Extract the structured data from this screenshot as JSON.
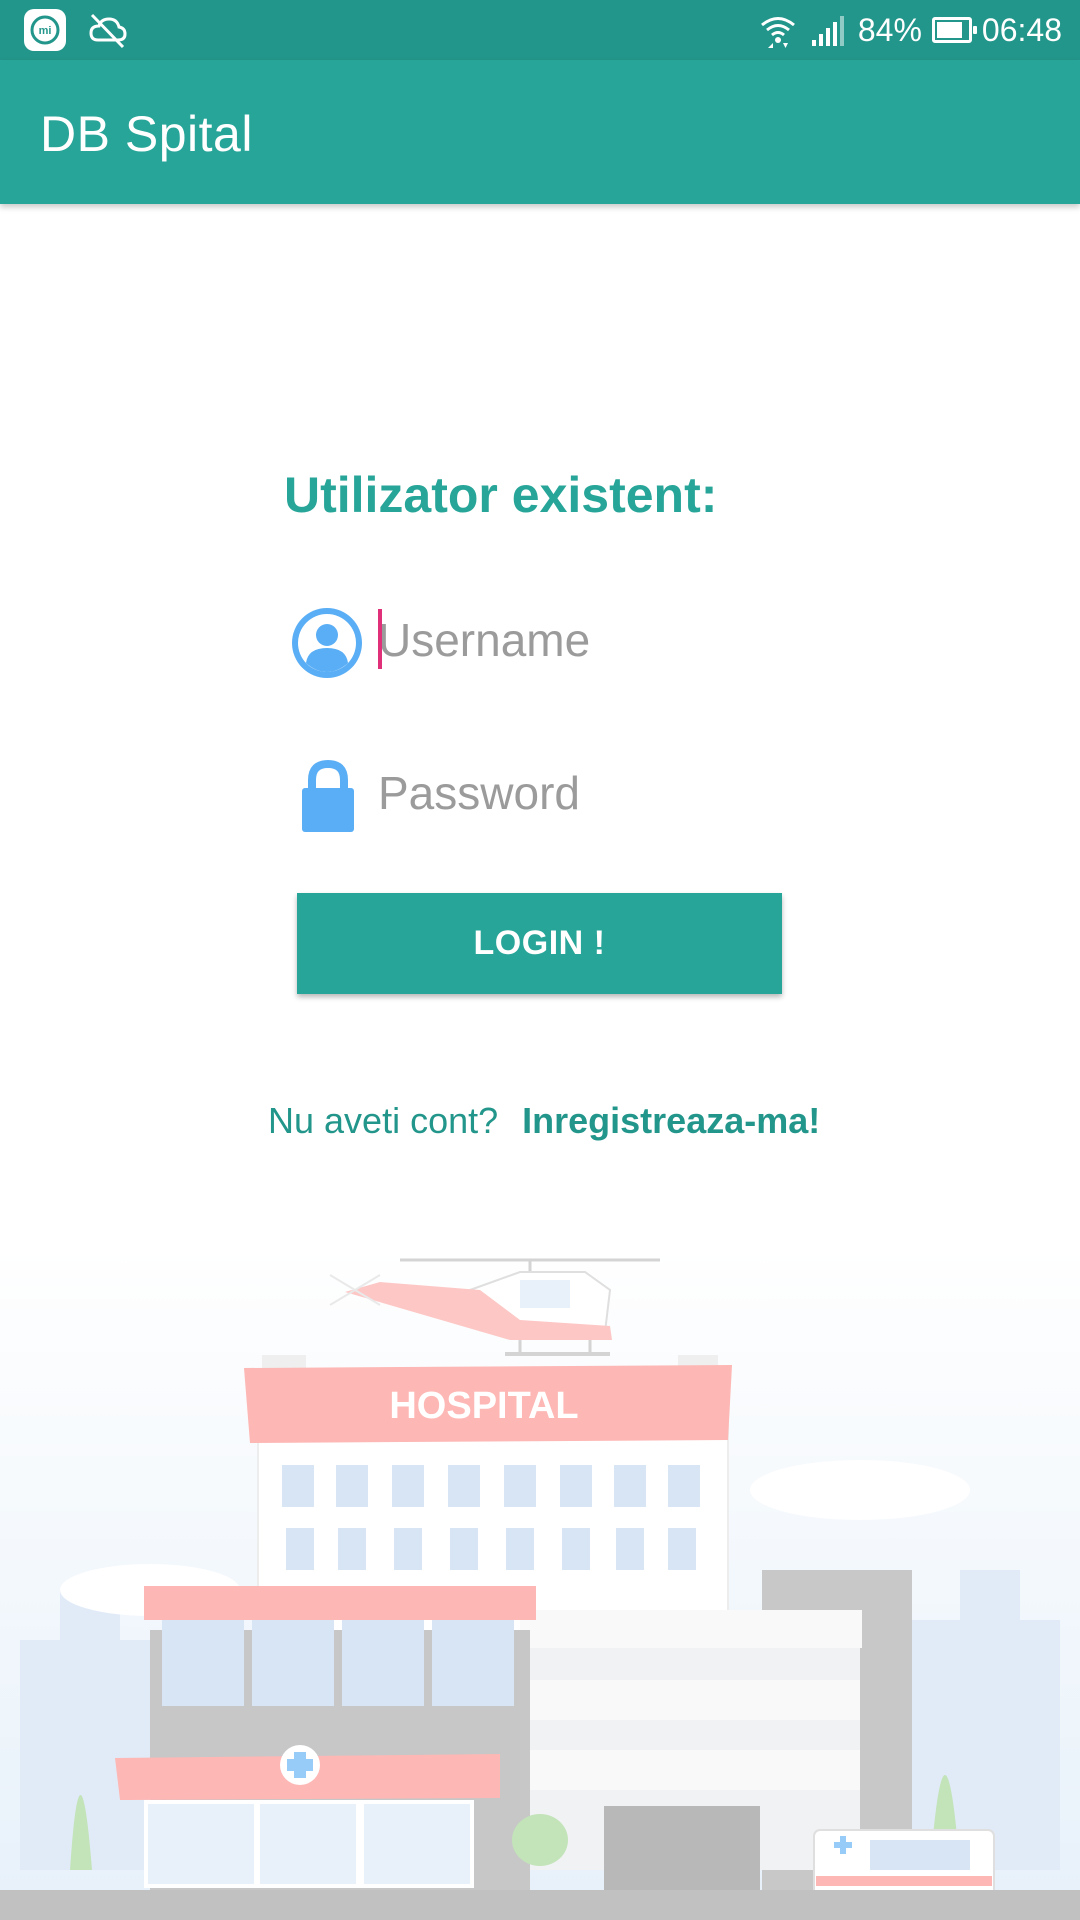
{
  "status_bar": {
    "battery": "84%",
    "battery_level": 0.84,
    "time": "06:48",
    "icons": [
      "miui-app-icon",
      "cloud-off-icon",
      "wifi-icon",
      "signal-icon",
      "battery-icon"
    ]
  },
  "app_bar": {
    "title": "DB Spital"
  },
  "login_form": {
    "heading": "Utilizator existent:",
    "username": {
      "placeholder": "Username",
      "value": "",
      "icon": "user-icon"
    },
    "password": {
      "placeholder": "Password",
      "value": "",
      "icon": "lock-icon"
    },
    "login_button": "LOGIN !"
  },
  "register": {
    "prompt": "Nu aveti cont?",
    "link": "Inregistreaza-ma!"
  },
  "illustration": {
    "sign_text": "HOSPITAL",
    "icon": "hospital-illustration"
  },
  "colors": {
    "primary": "#27a598",
    "primary_dark": "#23968b",
    "accent": "#e0307a",
    "icon_blue": "#5aaef5",
    "hospital_sign": "#fc8c87"
  }
}
